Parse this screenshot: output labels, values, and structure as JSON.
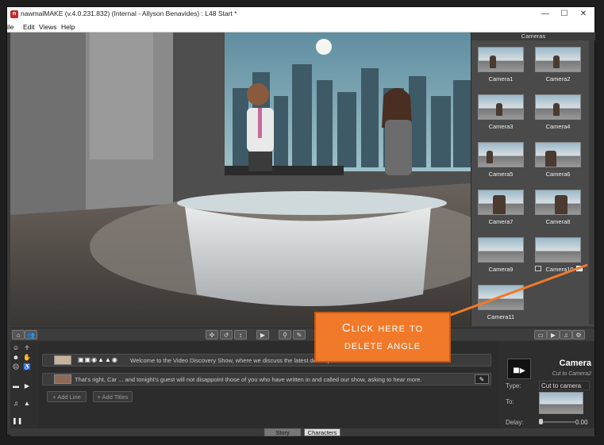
{
  "window": {
    "title": "nawmalMAKE (v.4.0.231.832) (Internal - Allyson Benavides) : L48 Start *",
    "logo_letter": "n",
    "controls": {
      "minimize": "—",
      "maximize": "☐",
      "close": "✕"
    }
  },
  "menu": [
    "ile",
    "Edit",
    "Views",
    "Help"
  ],
  "cameras": {
    "header": "Cameras",
    "items": [
      "Camera1",
      "Camera2",
      "Camera3",
      "Camera4",
      "Camera5",
      "Camera6",
      "Camera7",
      "Camera8",
      "Camera9",
      "Camera10",
      "Camera11"
    ]
  },
  "story": {
    "lines": [
      {
        "text": "Welcome to the Video Discovery Show, where we discuss the latest developm"
      },
      {
        "text": "That's right, Car  ...  and tonight's guest will not disappoint those of you who have written   in and called our show, asking to hear more."
      }
    ],
    "add_line": "+ Add Line",
    "add_titles": "+ Add Titles"
  },
  "properties": {
    "title": "Camera",
    "subtitle": "Cut to Camera2",
    "type_label": "Type:",
    "type_value": "Cut to camera",
    "to_label": "To:",
    "delay_label": "Delay:",
    "delay_value": "0.00"
  },
  "tabs": {
    "story": "Story",
    "characters": "Characters"
  },
  "callout": {
    "line1": "Click here to",
    "line2": "delete angle",
    "color": "#f07a2a"
  },
  "colors": {
    "accent_orange": "#f07a2a",
    "panel": "#3a3a3a"
  }
}
